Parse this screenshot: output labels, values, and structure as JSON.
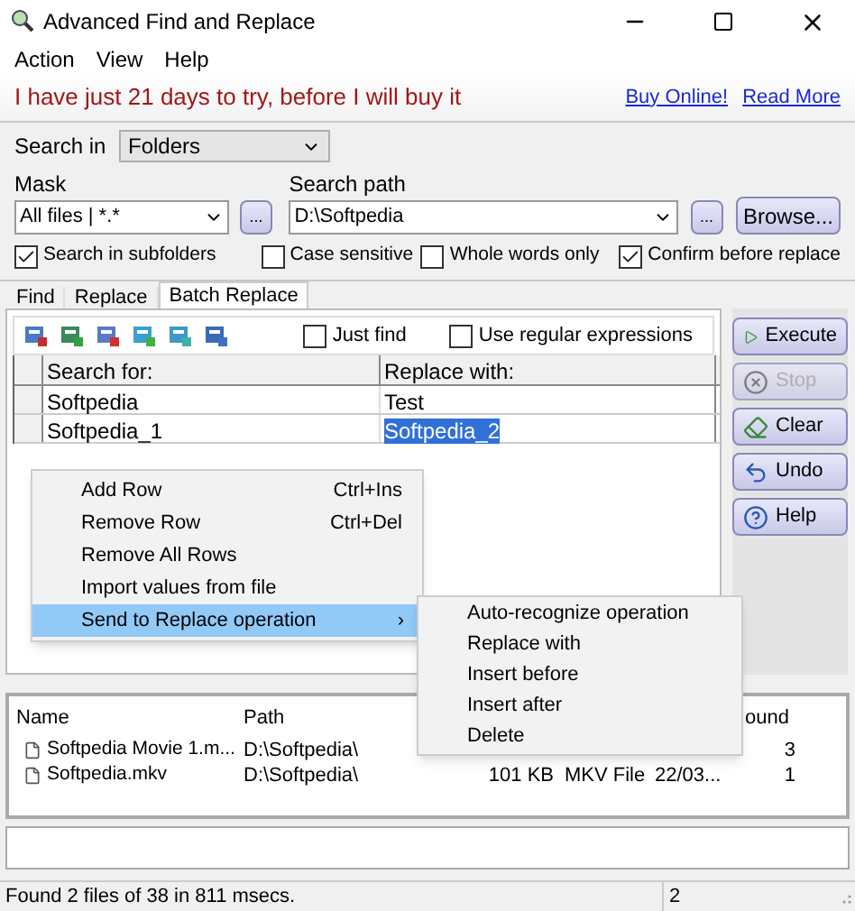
{
  "window": {
    "title": "Advanced Find and Replace"
  },
  "menu": [
    "Action",
    "View",
    "Help"
  ],
  "banner": {
    "message": "I have just 21 days to try, before I will buy it",
    "links": [
      "Buy Online!",
      "Read More"
    ]
  },
  "options": {
    "search_in_label": "Search in",
    "search_in": "Folders",
    "mask_label": "Mask",
    "mask": "All files | *.*",
    "mask_button": "...",
    "path_label": "Search path",
    "path": "D:\\Softpedia",
    "path_button": "...",
    "browse": "Browse...",
    "checks": [
      {
        "label": "Search in subfolders",
        "checked": true
      },
      {
        "label": "Case sensitive",
        "checked": false
      },
      {
        "label": "Whole words only",
        "checked": false
      },
      {
        "label": "Confirm before replace",
        "checked": true
      }
    ]
  },
  "tabs": [
    {
      "label": "Find",
      "selected": false
    },
    {
      "label": "Replace",
      "selected": false
    },
    {
      "label": "Batch Replace",
      "selected": true
    }
  ],
  "batch": {
    "toolbar_checks": [
      {
        "label": "Just find",
        "checked": false
      },
      {
        "label": "Use regular expressions",
        "checked": false
      }
    ],
    "columns": [
      "Search for:",
      "Replace with:"
    ],
    "rows": [
      {
        "search": "Softpedia",
        "replace": "Test",
        "replace_selected": false
      },
      {
        "search": "Softpedia_1",
        "replace": "Softpedia_2",
        "replace_selected": true
      }
    ]
  },
  "actions": [
    {
      "label": "Execute",
      "kind": "play",
      "disabled": false
    },
    {
      "label": "Stop",
      "kind": "stop",
      "disabled": true
    },
    {
      "label": "Clear",
      "kind": "clear",
      "disabled": false
    },
    {
      "label": "Undo",
      "kind": "undo",
      "disabled": false
    },
    {
      "label": "Help",
      "kind": "help",
      "disabled": false
    }
  ],
  "context_menu": [
    {
      "label": "Add Row",
      "shortcut": "Ctrl+Ins",
      "selected": false
    },
    {
      "label": "Remove Row",
      "shortcut": "Ctrl+Del",
      "selected": false
    },
    {
      "label": "Remove All Rows",
      "selected": false
    },
    {
      "label": "Import values from file",
      "selected": false
    },
    {
      "label": "Send to Replace operation",
      "arrow": "›",
      "selected": true
    }
  ],
  "submenu": [
    "Auto-recognize operation",
    "Replace with",
    "Insert before",
    "Insert after",
    "Delete"
  ],
  "results": {
    "columns": [
      "Name",
      "Path",
      "ound"
    ],
    "rows": [
      {
        "name": "Softpedia Movie 1.m...",
        "path": "D:\\Softpedia\\",
        "found": "3"
      },
      {
        "name": "Softpedia.mkv",
        "path": "D:\\Softpedia\\",
        "size": "101 KB",
        "type": "MKV File",
        "date": "22/03...",
        "found": "1"
      }
    ]
  },
  "status_bar": {
    "message": "Found 2 files of 38 in 811 msecs.",
    "count": "2"
  }
}
